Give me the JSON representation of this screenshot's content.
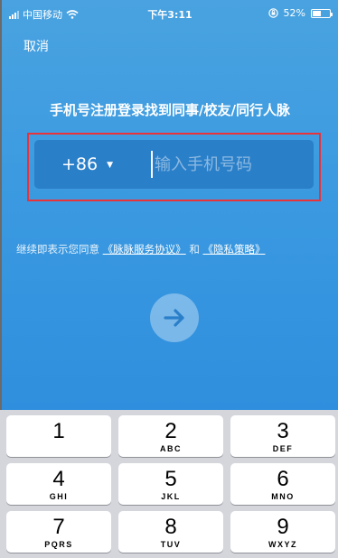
{
  "status_bar": {
    "carrier": "中国移动",
    "time": "下午3:11",
    "battery_percent": "52%",
    "battery_level": 0.52,
    "icons": [
      "signal-icon",
      "wifi-icon",
      "orientation-lock-icon",
      "battery-icon"
    ]
  },
  "nav": {
    "cancel_label": "取消"
  },
  "page": {
    "title": "手机号注册登录找到同事/校友/同行人脉"
  },
  "phone_form": {
    "country_code": "+86",
    "placeholder": "输入手机号码",
    "value": ""
  },
  "agreement": {
    "prefix": "继续即表示您同意",
    "service_link": "《脉脉服务协议》",
    "conjunction": "和",
    "privacy_link": "《隐私策略》"
  },
  "next_button": {
    "icon": "arrow-right-icon"
  },
  "keypad": {
    "keys": [
      {
        "num": "1",
        "letters": ""
      },
      {
        "num": "2",
        "letters": "ABC"
      },
      {
        "num": "3",
        "letters": "DEF"
      },
      {
        "num": "4",
        "letters": "GHI"
      },
      {
        "num": "5",
        "letters": "JKL"
      },
      {
        "num": "6",
        "letters": "MNO"
      },
      {
        "num": "7",
        "letters": "PQRS"
      },
      {
        "num": "8",
        "letters": "TUV"
      },
      {
        "num": "9",
        "letters": "WXYZ"
      }
    ]
  },
  "colors": {
    "background_top": "#4aa3e0",
    "background_bottom": "#2f8fde",
    "input_box": "#2a7fc9",
    "highlight_border": "#e8333a",
    "keyboard_bg": "#d4d6dc"
  }
}
